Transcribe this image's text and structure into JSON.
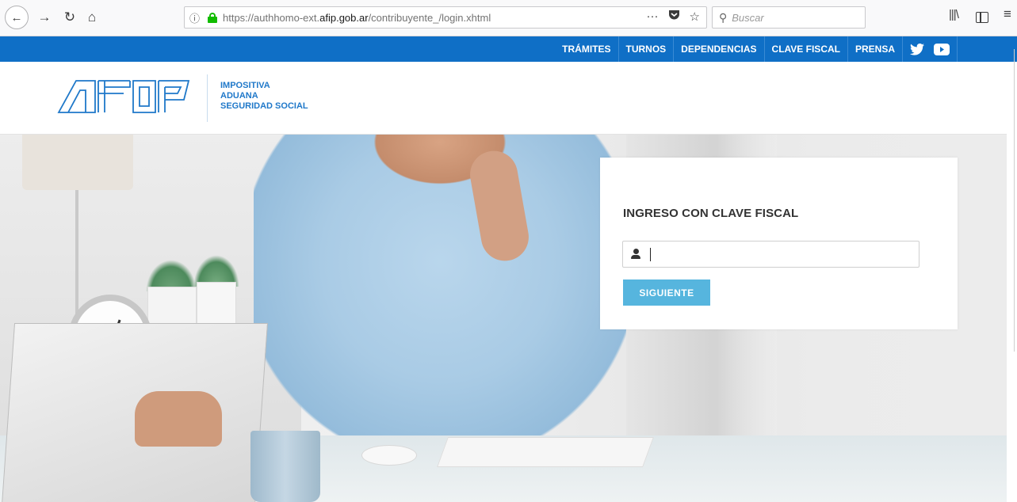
{
  "browser": {
    "url_prefix": "https://authhomo-ext.",
    "url_domain": "afip.gob.ar",
    "url_path": "/contribuyente_/login.xhtml",
    "info_glyph": "ⓘ",
    "page_actions_glyph": "···",
    "search_placeholder": "Buscar"
  },
  "topnav": {
    "items": [
      "TRÁMITES",
      "TURNOS",
      "DEPENDENCIAS",
      "CLAVE FISCAL",
      "PRENSA"
    ],
    "color": "#0f6fc6"
  },
  "header": {
    "logo_text": "AFIP",
    "tagline": [
      "IMPOSITIVA",
      "ADUANA",
      "SEGURIDAD SOCIAL"
    ],
    "accent_color": "#1f78c9"
  },
  "login": {
    "title": "INGRESO CON CLAVE FISCAL",
    "username_value": "",
    "next_label": "SIGUIENTE",
    "button_color": "#56b5de"
  },
  "icons": [
    "back-icon",
    "forward-icon",
    "reload-icon",
    "home-icon",
    "pocket-icon",
    "bookmark-star-icon",
    "search-icon",
    "library-icon",
    "sidebar-icon",
    "menu-icon",
    "twitter-icon",
    "youtube-icon",
    "user-icon"
  ]
}
